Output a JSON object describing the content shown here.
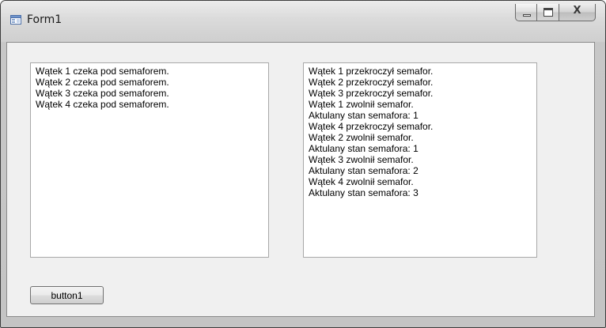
{
  "window": {
    "title": "Form1"
  },
  "caption_buttons": {
    "minimize_icon": "minimize-icon",
    "maximize_icon": "maximize-icon",
    "close_glyph": "X"
  },
  "left_list": {
    "items": [
      "Wątek 1 czeka pod semaforem.",
      "Wątek 2 czeka pod semaforem.",
      "Wątek 3 czeka pod semaforem.",
      "Wątek 4 czeka pod semaforem."
    ]
  },
  "right_list": {
    "items": [
      "Wątek 1 przekroczył semafor.",
      "Wątek 2 przekroczył semafor.",
      "Wątek 3 przekroczył semafor.",
      "Wątek 1 zwolnił semafor.",
      "Aktulany stan semafora: 1",
      "Wątek 4 przekroczył semafor.",
      "Wątek 2 zwolnił semafor.",
      "Aktulany stan semafora: 1",
      "Wątek 3 zwolnił semafor.",
      "Aktulany stan semafora: 2",
      "Wątek 4 zwolnił semafor.",
      "Aktulany stan semafora: 3"
    ]
  },
  "button1": {
    "label": "button1"
  }
}
